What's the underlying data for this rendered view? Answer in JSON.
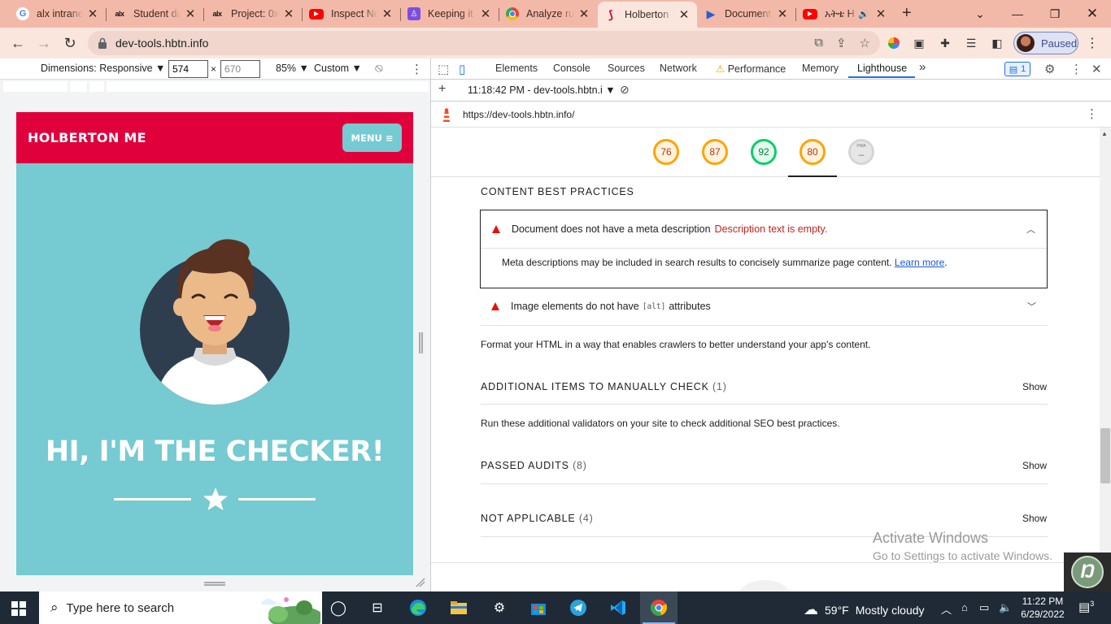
{
  "browser": {
    "tabs": [
      {
        "title": "alx intranet",
        "favicon": "google-icon"
      },
      {
        "title": "Student dashboard",
        "favicon": "alx-icon"
      },
      {
        "title": "Project: 0x",
        "favicon": "alx-icon"
      },
      {
        "title": "Inspect Network",
        "favicon": "youtube-icon"
      },
      {
        "title": "Keeping it",
        "favicon": "keep-icon"
      },
      {
        "title": "Analyze runtime",
        "favicon": "chrome-icon"
      },
      {
        "title": "Holberton",
        "favicon": "holberton-icon"
      },
      {
        "title": "Document",
        "favicon": "document-icon"
      },
      {
        "title": "አትቴ H",
        "favicon": "youtube-icon"
      }
    ],
    "active_tab_index": 6,
    "favicon_glyphs": {
      "alx": "alx",
      "google": "G",
      "holberton": "⟆",
      "document": "▶"
    },
    "url": "dev-tools.hbtn.info",
    "profile_status": "Paused"
  },
  "device_toolbar": {
    "dimensions_label": "Dimensions: Responsive ▼",
    "width": "574",
    "height": "670",
    "times": "×",
    "zoom": "85% ▼",
    "throttle": "Custom ▼"
  },
  "emulated_page": {
    "logo": "HOLBERTON ME",
    "menu_label": "MENU",
    "hero_title": "HI, I'M THE CHECKER!",
    "colors": {
      "header": "#e0003c",
      "body": "#76cad1"
    }
  },
  "devtools": {
    "tabs": [
      "Elements",
      "Console",
      "Sources",
      "Network",
      "Performance",
      "Memory",
      "Lighthouse"
    ],
    "active_tab": "Lighthouse",
    "more_tabs": "»",
    "issues_count": "1",
    "report_selector": "11:18:42 PM - dev-tools.hbtn.i ▼",
    "audited_url": "https://dev-tools.hbtn.info/"
  },
  "lighthouse": {
    "scores": [
      {
        "value": "76",
        "color": "orange"
      },
      {
        "value": "87",
        "color": "orange"
      },
      {
        "value": "92",
        "color": "green"
      },
      {
        "value": "80",
        "color": "orange"
      }
    ],
    "pwa_label": "PWA",
    "pwa_value": "–",
    "section_title": "CONTENT BEST PRACTICES",
    "audit1": {
      "title": "Document does not have a meta description",
      "error": "Description text is empty.",
      "description": "Meta descriptions may be included in search results to concisely summarize page content.",
      "link": "Learn more",
      "link_tail": "."
    },
    "audit2": {
      "title_before": "Image elements do not have",
      "code": "[alt]",
      "title_after": "attributes"
    },
    "section_desc": "Format your HTML in a way that enables crawlers to better understand your app's content.",
    "manual": {
      "title": "ADDITIONAL ITEMS TO MANUALLY CHECK",
      "count": "(1)",
      "desc": "Run these additional validators on your site to check additional SEO best practices.",
      "show": "Show"
    },
    "passed": {
      "title": "PASSED AUDITS",
      "count": "(8)",
      "show": "Show"
    },
    "not_applicable": {
      "title": "NOT APPLICABLE",
      "count": "(4)",
      "show": "Show"
    }
  },
  "watermark": {
    "line1": "Activate Windows",
    "line2": "Go to Settings to activate Windows."
  },
  "taskbar": {
    "search_placeholder": "Type here to search",
    "weather_temp": "59°F",
    "weather_text": "Mostly cloudy",
    "time": "11:22 PM",
    "date": "6/29/2022",
    "notifications": "3"
  }
}
